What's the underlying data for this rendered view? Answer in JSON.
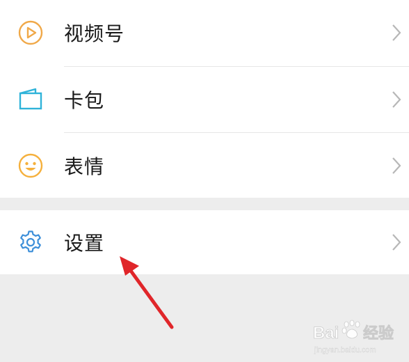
{
  "menu": {
    "items": [
      {
        "id": "channels",
        "label": "视频号",
        "icon": "channels-play-icon",
        "icon_color": "#f0a848"
      },
      {
        "id": "cards",
        "label": "卡包",
        "icon": "card-wallet-icon",
        "icon_color": "#2fb3d9"
      },
      {
        "id": "stickers",
        "label": "表情",
        "icon": "smiley-icon",
        "icon_color": "#f5b03c"
      },
      {
        "id": "settings",
        "label": "设置",
        "icon": "gear-icon",
        "icon_color": "#3d8fd9"
      }
    ],
    "chevron_icon": "chevron-right-icon",
    "chevron_color": "#b7b7b7"
  },
  "annotation": {
    "arrow_icon": "red-arrow-icon",
    "color": "#e0262a"
  },
  "watermark": {
    "text": "Bai 经验",
    "sub": "jingyan.baidu.com",
    "icon": "baidu-paw-icon"
  }
}
